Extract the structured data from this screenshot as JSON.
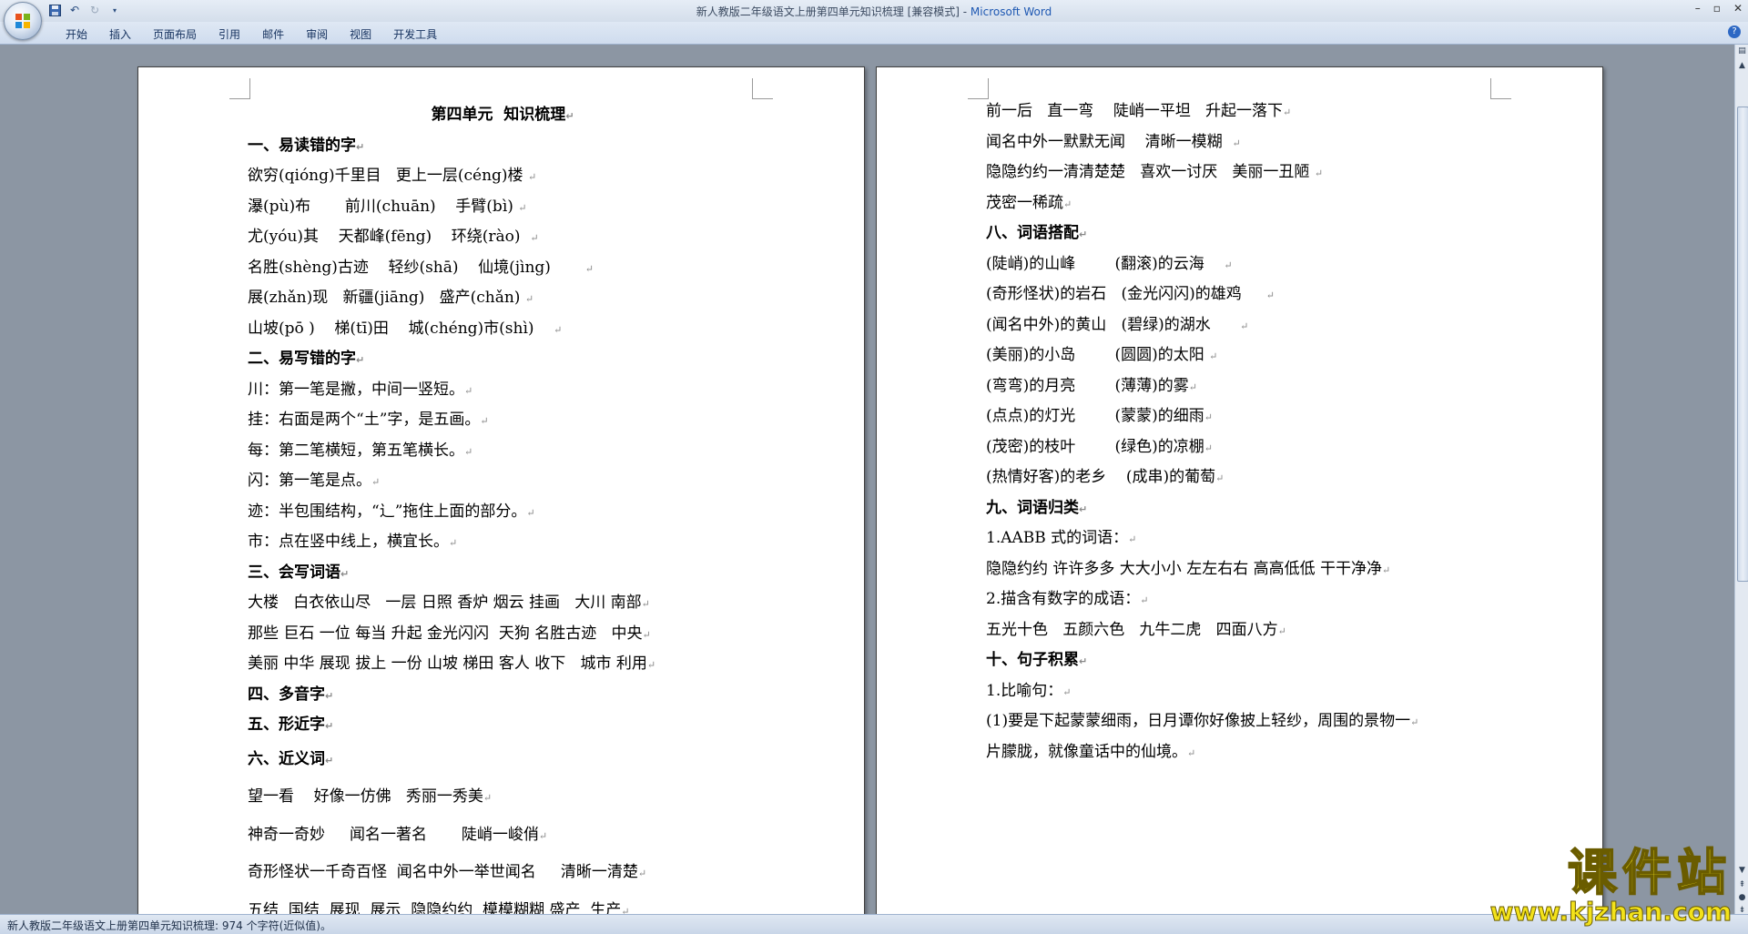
{
  "window": {
    "title_doc": "新人教版二年级语文上册第四单元知识梳理 [兼容模式] - ",
    "title_app": "Microsoft Word"
  },
  "ribbon": {
    "tabs": [
      "开始",
      "插入",
      "页面布局",
      "引用",
      "邮件",
      "审阅",
      "视图",
      "开发工具"
    ]
  },
  "left_page": {
    "title": "第四单元  知识梳理",
    "lines": [
      {
        "text": "一、易读错的字",
        "bold": true
      },
      {
        "text": "欲穷(qióng)千里目   更上一层(céng)楼 "
      },
      {
        "text": "瀑(pù)布       前川(chuān)    手臂(bì) "
      },
      {
        "text": "尤(yóu)其    天都峰(fēng)    环绕(rào)  "
      },
      {
        "text": "名胜(shèng)古迹    轻纱(shā)    仙境(jìng)       "
      },
      {
        "text": "展(zhǎn)现   新疆(jiāng)   盛产(chǎn) "
      },
      {
        "text": "山坡(pō )    梯(tī)田    城(chéng)市(shì)    "
      },
      {
        "text": "二、易写错的字",
        "bold": true
      },
      {
        "text": "川：第一笔是撇，中间一竖短。"
      },
      {
        "text": "挂：右面是两个“土”字，是五画。"
      },
      {
        "text": "每：第二笔横短，第五笔横长。"
      },
      {
        "text": "闪：第一笔是点。"
      },
      {
        "text": "迹：半包围结构，“辶”拖住上面的部分。"
      },
      {
        "text": "市：点在竖中线上，横宜长。"
      },
      {
        "text": "三、会写词语",
        "bold": true
      },
      {
        "text": "大楼   白衣依山尽   一层 日照 香炉 烟云 挂画   大川 南部"
      },
      {
        "text": "那些 巨石 一位 每当 升起 金光闪闪  天狗 名胜古迹   中央"
      },
      {
        "text": "美丽 中华 展现 拔上 一份 山坡 梯田 客人 收下   城市 利用"
      },
      {
        "text": "四、多音字",
        "bold": true
      },
      {
        "text": "五、形近字",
        "bold": true
      },
      {
        "text": "六、近义词",
        "bold": true,
        "big": true
      },
      {
        "text": "望一看    好像一仿佛   秀丽一秀美",
        "big": true
      },
      {
        "text": "神奇一奇妙     闻名一著名       陡峭一峻俏",
        "big": true
      },
      {
        "text": "奇形怪状一千奇百怪  闻名中外一举世闻名     清晰一清楚",
        "big": true
      },
      {
        "text": "五结  国结  展现  展示  隐隐约约  模模糊糊 盛产  生产",
        "big": true
      }
    ]
  },
  "right_page": {
    "lines": [
      {
        "text": "前一后   直一弯    陡峭一平坦   升起一落下"
      },
      {
        "text": "闻名中外一默默无闻    清晰一模糊  "
      },
      {
        "text": "隐隐约约一清清楚楚   喜欢一讨厌   美丽一丑陋 "
      },
      {
        "text": "茂密一稀疏"
      },
      {
        "text": "八、词语搭配",
        "bold": true
      },
      {
        "text": "(陡峭)的山峰        (翻滚)的云海    "
      },
      {
        "text": "(奇形怪状)的岩石   (金光闪闪)的雄鸡     "
      },
      {
        "text": "(闻名中外)的黄山   (碧绿)的湖水      "
      },
      {
        "text": "(美丽)的小岛        (圆圆)的太阳 "
      },
      {
        "text": "(弯弯)的月亮        (薄薄)的雾"
      },
      {
        "text": "(点点)的灯光        (蒙蒙)的细雨"
      },
      {
        "text": "(茂密)的枝叶        (绿色)的凉棚"
      },
      {
        "text": "(热情好客)的老乡    (成串)的葡萄"
      },
      {
        "text": "九、词语归类",
        "bold": true
      },
      {
        "text": "1.AABB 式的词语："
      },
      {
        "text": "隐隐约约 许许多多 大大小小 左左右右 高高低低 干干净净"
      },
      {
        "text": "2.描含有数字的成语："
      },
      {
        "text": "五光十色   五颜六色   九牛二虎   四面八方"
      },
      {
        "text": "十、句子积累",
        "bold": true
      },
      {
        "text": "1.比喻句："
      },
      {
        "text": "(1)要是下起蒙蒙细雨，日月谭你好像披上轻纱，周围的景物一"
      },
      {
        "text": "片朦胧，就像童话中的仙境。"
      }
    ]
  },
  "status": {
    "text": "新人教版二年级语文上册第四单元知识梳理: 974 个字符(近似值)。"
  },
  "watermark": {
    "main": "课件站",
    "url": "www.kjzhan.com"
  },
  "colors": {
    "workspace": "#8c96a3",
    "ribbon": "#dfe8f4",
    "app_title": "#1e58b2",
    "watermark": "#f3e21a"
  },
  "paragraph_mark": "↵"
}
